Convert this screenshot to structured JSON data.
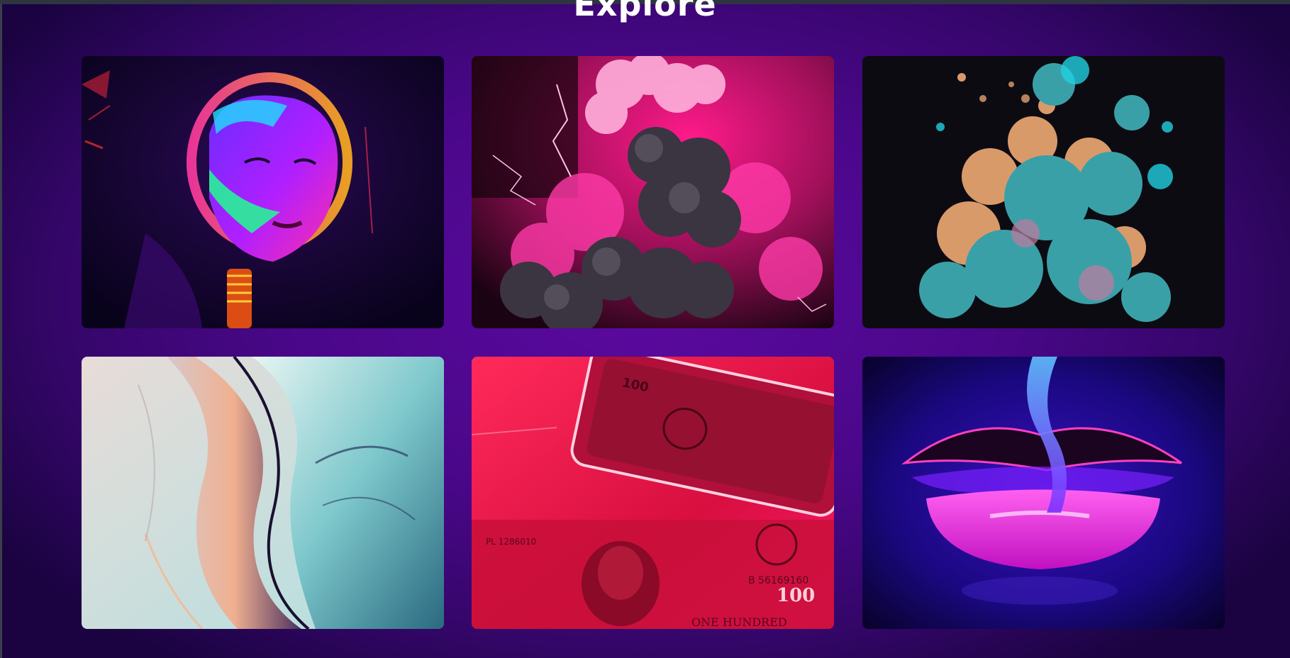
{
  "page": {
    "title": "Explore"
  },
  "gallery": {
    "items": [
      {
        "icon": "neon-face-image"
      },
      {
        "icon": "pink-smoke-cloud-image"
      },
      {
        "icon": "ink-cloud-image"
      },
      {
        "icon": "abstract-wave-image"
      },
      {
        "icon": "neon-money-phone-image"
      },
      {
        "icon": "neon-lips-image"
      }
    ]
  },
  "colors": {
    "background": "#4a078a",
    "title": "#ffffff"
  }
}
